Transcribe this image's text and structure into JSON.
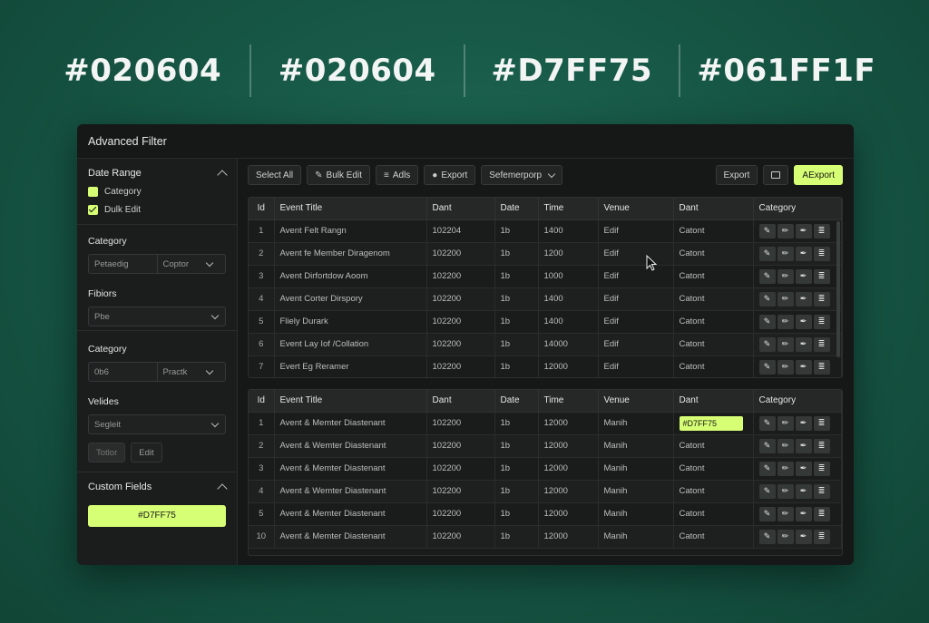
{
  "palette": [
    "#020604",
    "#020604",
    "#D7FF75",
    "#061FF1F"
  ],
  "window": {
    "title": "Advanced Filter"
  },
  "sidebar": {
    "date_range": {
      "heading": "Date Range",
      "checkboxes": [
        {
          "label": "Category",
          "checked": false
        },
        {
          "label": "Dulk Edit",
          "checked": true
        }
      ]
    },
    "category1": {
      "label": "Category",
      "value_a": "Petaedig",
      "value_b": "Coptor"
    },
    "filters": {
      "label": "Fibiors",
      "value": "Pbe"
    },
    "category2": {
      "label": "Category",
      "value_a": "0b6",
      "value_b": "Practk"
    },
    "venues": {
      "label": "Velides",
      "value": "Segleit",
      "btn_a": "Totlor",
      "btn_b": "Edit"
    },
    "custom_fields": {
      "heading": "Custom Fields",
      "value": "#D7FF75"
    }
  },
  "toolbar": {
    "select_all": "Select All",
    "bulk_edit": "Bulk Edit",
    "adds": "Adls",
    "export": "Export",
    "dropdown": "Sefemerporp",
    "export_right": "Export",
    "primary": "AExport"
  },
  "columns": [
    "Id",
    "Event Title",
    "Dant",
    "Date",
    "Time",
    "Venue",
    "Dant",
    "Category"
  ],
  "table1": [
    [
      "1",
      "Avent Felt Rangn",
      "102204",
      "1b",
      "1400",
      "Edif",
      "Catont"
    ],
    [
      "2",
      "Avent fe Member Diragenom",
      "102200",
      "1b",
      "1200",
      "Edif",
      "Catont"
    ],
    [
      "3",
      "Avent Dirfortdow Aoom",
      "102200",
      "1b",
      "1000",
      "Edif",
      "Catont"
    ],
    [
      "4",
      "Avent Corter Dirspory",
      "102200",
      "1b",
      "1400",
      "Edif",
      "Catont"
    ],
    [
      "5",
      "Fliely Durark",
      "102200",
      "1b",
      "1400",
      "Edif",
      "Catont"
    ],
    [
      "6",
      "Event Lay Iof /Collation",
      "102200",
      "1b",
      "14000",
      "Edif",
      "Catont"
    ],
    [
      "7",
      "Evert Eg Reramer",
      "102200",
      "1b",
      "12000",
      "Edif",
      "Catont"
    ]
  ],
  "table2": [
    [
      "1",
      "Avent & Memter Diastenant",
      "102200",
      "1b",
      "12000",
      "Manih",
      "#D7FF75"
    ],
    [
      "2",
      "Avent & Wemter Diastenant",
      "102200",
      "1b",
      "12000",
      "Manih",
      "Catont"
    ],
    [
      "3",
      "Avent & Memter Diastenant",
      "102200",
      "1b",
      "12000",
      "Manih",
      "Catont"
    ],
    [
      "4",
      "Avent & Wemter Diastenant",
      "102200",
      "1b",
      "12000",
      "Manih",
      "Catont"
    ],
    [
      "5",
      "Avent & Memter Diastenant",
      "102200",
      "1b",
      "12000",
      "Manih",
      "Catont"
    ],
    [
      "10",
      "Avent & Memter Diastenant",
      "102200",
      "1b",
      "12000",
      "Manih",
      "Catont"
    ]
  ],
  "colors": {
    "accent": "#D7FF75",
    "background": "#175846",
    "panel": "#161817"
  },
  "icons": {
    "edit": "pencil-icon",
    "list": "list-icon",
    "export": "export-icon",
    "adds": "adds-icon"
  }
}
